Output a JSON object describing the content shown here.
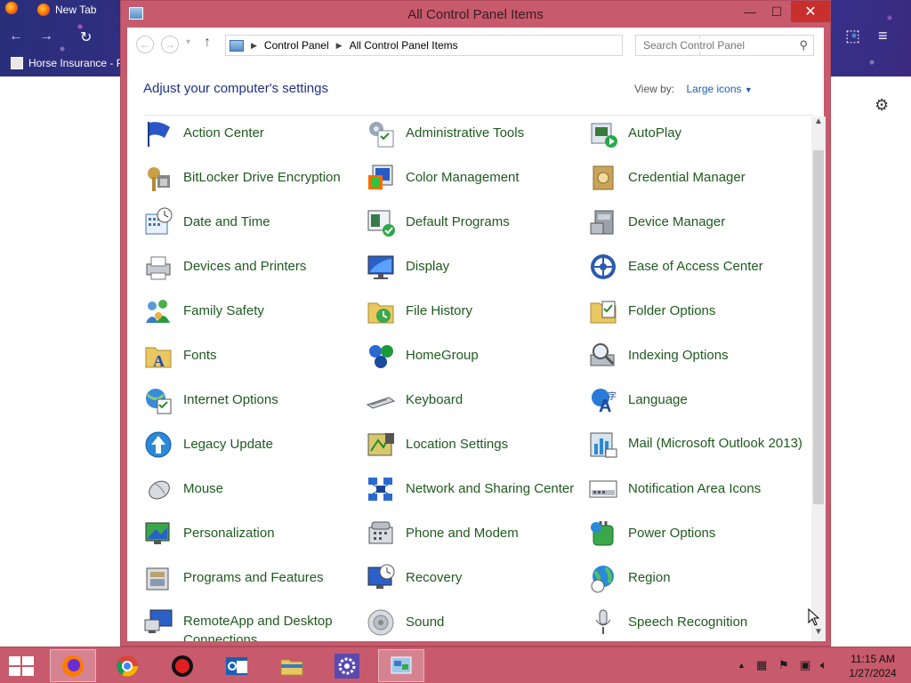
{
  "browser": {
    "tab_label": "New Tab",
    "bookmark_label": "Horse Insurance - P"
  },
  "window": {
    "title": "All Control Panel Items",
    "controls": {
      "minimize": "—",
      "maximize": "☐",
      "close": "✕"
    }
  },
  "address": {
    "crumbs": [
      "Control Panel",
      "All Control Panel Items"
    ],
    "search_placeholder": "Search Control Panel"
  },
  "header": {
    "title": "Adjust your computer's settings",
    "view_by_label": "View by:",
    "view_by_value": "Large icons"
  },
  "items": [
    {
      "label": "Action Center",
      "icon": "flag-icon"
    },
    {
      "label": "Administrative Tools",
      "icon": "admin-tools-icon"
    },
    {
      "label": "AutoPlay",
      "icon": "autoplay-icon"
    },
    {
      "label": "BitLocker Drive Encryption",
      "icon": "bitlocker-icon"
    },
    {
      "label": "Color Management",
      "icon": "color-management-icon"
    },
    {
      "label": "Credential Manager",
      "icon": "credential-manager-icon"
    },
    {
      "label": "Date and Time",
      "icon": "date-time-icon"
    },
    {
      "label": "Default Programs",
      "icon": "default-programs-icon"
    },
    {
      "label": "Device Manager",
      "icon": "device-manager-icon"
    },
    {
      "label": "Devices and Printers",
      "icon": "printer-icon"
    },
    {
      "label": "Display",
      "icon": "display-icon"
    },
    {
      "label": "Ease of Access Center",
      "icon": "ease-of-access-icon"
    },
    {
      "label": "Family Safety",
      "icon": "family-safety-icon"
    },
    {
      "label": "File History",
      "icon": "file-history-icon"
    },
    {
      "label": "Folder Options",
      "icon": "folder-options-icon"
    },
    {
      "label": "Fonts",
      "icon": "fonts-icon"
    },
    {
      "label": "HomeGroup",
      "icon": "homegroup-icon"
    },
    {
      "label": "Indexing Options",
      "icon": "indexing-icon"
    },
    {
      "label": "Internet Options",
      "icon": "internet-options-icon"
    },
    {
      "label": "Keyboard",
      "icon": "keyboard-icon"
    },
    {
      "label": "Language",
      "icon": "language-icon"
    },
    {
      "label": "Legacy Update",
      "icon": "legacy-update-icon"
    },
    {
      "label": "Location Settings",
      "icon": "location-icon"
    },
    {
      "label": "Mail (Microsoft Outlook 2013)",
      "icon": "mail-icon"
    },
    {
      "label": "Mouse",
      "icon": "mouse-icon"
    },
    {
      "label": "Network and Sharing Center",
      "icon": "network-icon"
    },
    {
      "label": "Notification Area Icons",
      "icon": "notification-area-icon"
    },
    {
      "label": "Personalization",
      "icon": "personalization-icon"
    },
    {
      "label": "Phone and Modem",
      "icon": "phone-modem-icon"
    },
    {
      "label": "Power Options",
      "icon": "power-options-icon"
    },
    {
      "label": "Programs and Features",
      "icon": "programs-features-icon"
    },
    {
      "label": "Recovery",
      "icon": "recovery-icon"
    },
    {
      "label": "Region",
      "icon": "region-icon"
    },
    {
      "label": "RemoteApp and Desktop Connections",
      "icon": "remoteapp-icon"
    },
    {
      "label": "Sound",
      "icon": "sound-icon"
    },
    {
      "label": "Speech Recognition",
      "icon": "microphone-icon"
    }
  ],
  "taskbar": {
    "apps": [
      "firefox-icon",
      "chrome-icon",
      "record-icon",
      "outlook-icon",
      "file-explorer-icon",
      "settings-icon",
      "control-panel-icon"
    ],
    "clock_time": "11:15 AM",
    "clock_date": "1/27/2024"
  },
  "colors": {
    "accent": "#c75a6c",
    "link_green": "#1e5a1e",
    "header_blue": "#1e3287"
  }
}
